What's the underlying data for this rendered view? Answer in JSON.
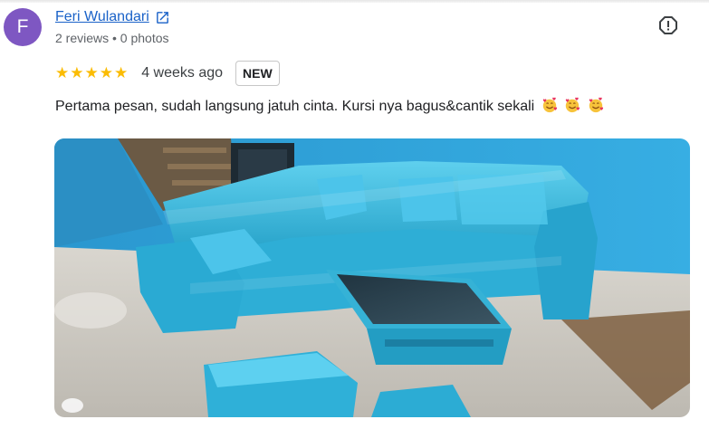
{
  "review": {
    "avatar_letter": "F",
    "avatar_color": "#7e57c2",
    "author_name": "Feri Wulandari",
    "author_meta": "2 reviews • 0 photos",
    "rating": 5,
    "stars": "★★★★★",
    "time": "4 weeks ago",
    "badge": "NEW",
    "text": "Pertama pesan, sudah langsung jatuh cinta. Kursi nya bagus&cantik sekali",
    "emoji_count": 3,
    "icons": {
      "author_link": "open-in-new-icon",
      "report": "report-icon",
      "reaction": "smiling-face-with-hearts-icon"
    },
    "photo_alt": "Blue sofa set with coffee table and ottomans"
  },
  "colors": {
    "link": "#1a62c8",
    "star": "#fbbc04",
    "wall": "#2fa5dd",
    "sofa": "#35b2d6"
  }
}
